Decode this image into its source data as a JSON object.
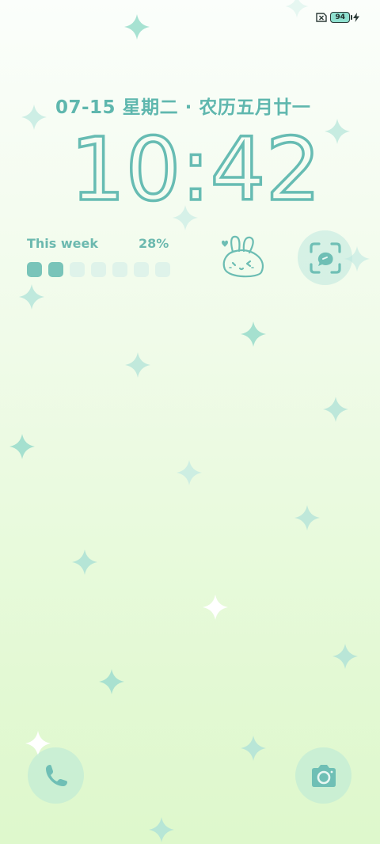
{
  "status_bar": {
    "sim_icon": "no-sim-icon",
    "battery_level": "94",
    "charging_icon": "charging-bolt-icon"
  },
  "lockscreen": {
    "date_text": "07-15 星期二 · 农历五月廿一",
    "time_text": "10:42"
  },
  "week_widget": {
    "label": "This week",
    "percent_text": "28%",
    "days_filled": 2,
    "days_total": 7
  },
  "sticker": {
    "icon": "bunny-sticker-icon"
  },
  "shortcuts": {
    "scan_icon": "scan-icon",
    "phone_icon": "phone-icon",
    "camera_icon": "camera-icon"
  },
  "colors": {
    "accent": "#67bcb3",
    "accent_light": "#dff3ea",
    "bg_top": "#fbfefb",
    "bg_bottom": "#def8cc"
  }
}
